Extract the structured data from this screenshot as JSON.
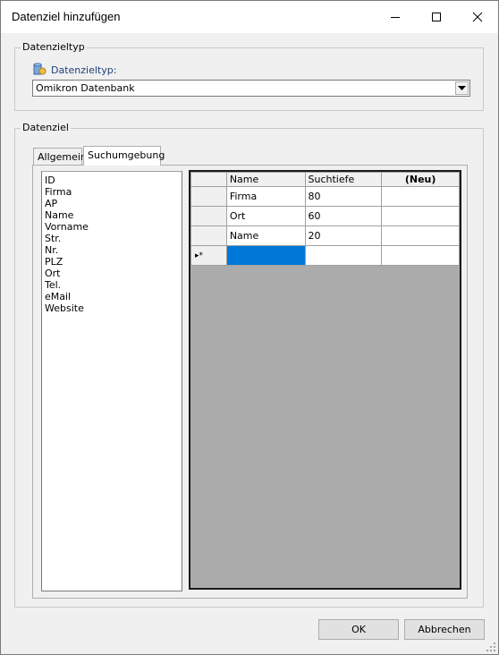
{
  "window": {
    "title": "Datenziel hinzufügen"
  },
  "group_datenzieltyp": {
    "legend": "Datenzieltyp",
    "label": "Datenzieltyp:",
    "combo_value": "Omikron Datenbank"
  },
  "group_datenziel": {
    "legend": "Datenziel",
    "tabs": [
      {
        "label": "Allgemein"
      },
      {
        "label": "Suchumgebung"
      }
    ],
    "fields": [
      "ID",
      "Firma",
      "AP",
      "Name",
      "Vorname",
      "Str.",
      "Nr.",
      "PLZ",
      "Ort",
      "Tel.",
      "eMail",
      "Website"
    ],
    "grid": {
      "headers": {
        "name": "Name",
        "suchtiefe": "Suchtiefe",
        "neu": "(Neu)"
      },
      "rows": [
        {
          "name": "Firma",
          "suchtiefe": "80"
        },
        {
          "name": "Ort",
          "suchtiefe": "60"
        },
        {
          "name": "Name",
          "suchtiefe": "20"
        }
      ],
      "new_row_marker": "▸*"
    }
  },
  "buttons": {
    "ok": "OK",
    "cancel": "Abbrechen"
  },
  "colors": {
    "selection": "#0078d7",
    "grid_background": "#ababab"
  }
}
